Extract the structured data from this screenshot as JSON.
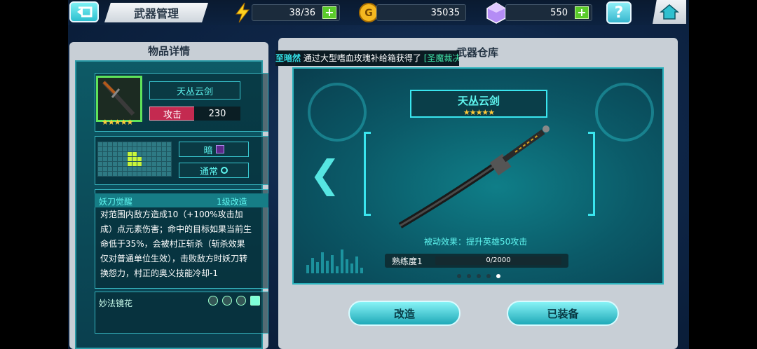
{
  "topbar": {
    "title": "武器管理",
    "energy": "38/36",
    "gold": "35035",
    "gems": "550"
  },
  "left": {
    "header": "物品详情",
    "weapon_name": "天丛云剑",
    "stars": "★★★★★",
    "attack_label": "攻击",
    "attack_value": "230",
    "element_tag": "暗",
    "type_tag": "通常",
    "skill_title": "妖刀觉醒",
    "skill_level": "1级改造",
    "skill_desc": "对范围内敌方造成10（+100%攻击加成）点元素伤害；命中的目标如果当前生命低于35%，会被村正斩杀（斩杀效果仅对普通单位生效），击败敌方时妖刀转换怨力，村正的奥义技能冷却-1",
    "sub_title": "妙法镜花"
  },
  "right": {
    "header": "武器仓库",
    "ticker_player": "至暗然",
    "ticker_text": "通过大型嗜血玫瑰补给箱获得了",
    "ticker_item": "[圣魔裁决]",
    "weapon_name": "天丛云剑",
    "stars": "★★★★★",
    "passive": "被动效果：提升英雄50攻击",
    "proficiency_label": "熟练度1",
    "proficiency_value": "0/2000",
    "proficiency_fraction": 0,
    "page_count": 5,
    "active_page": 5,
    "modify_button": "改造",
    "equipped_button": "已装备"
  },
  "colors": {
    "accent": "#3ae5ee",
    "attack": "#c42a50",
    "plus": "#5acb2a",
    "star": "#ffc93a"
  }
}
